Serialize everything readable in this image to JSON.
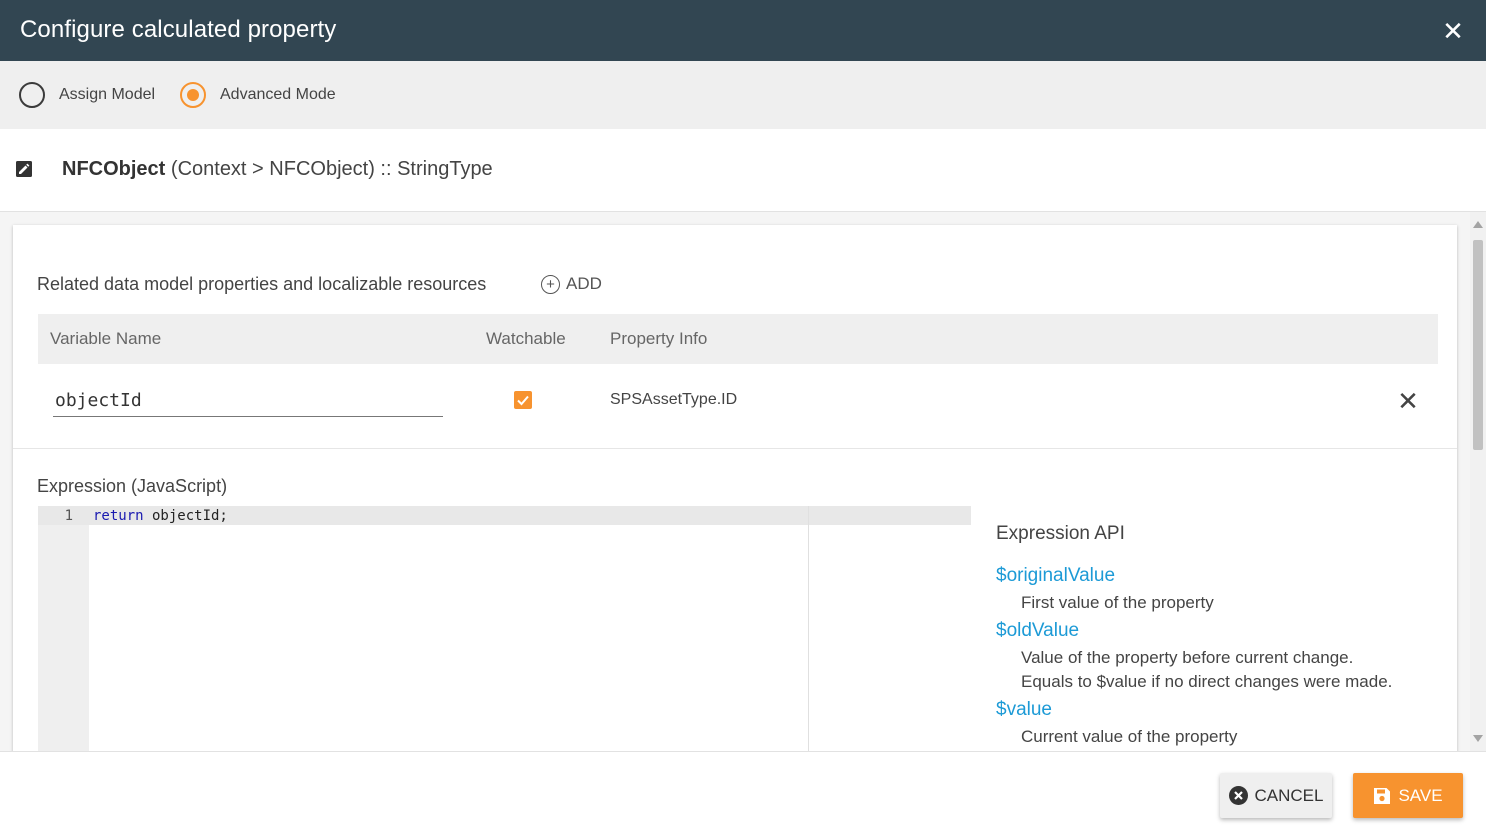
{
  "dialog": {
    "title": "Configure calculated property",
    "close_glyph": "✕"
  },
  "mode": {
    "options": [
      {
        "label": "Assign Model",
        "selected": false
      },
      {
        "label": "Advanced Mode",
        "selected": true
      }
    ]
  },
  "context": {
    "icon": "edit-square-icon",
    "object_name": "NFCObject",
    "path": "(Context > NFCObject) :: StringType"
  },
  "related": {
    "title": "Related data model properties and localizable resources",
    "add_label": "ADD",
    "columns": [
      "Variable Name",
      "Watchable",
      "Property Info"
    ],
    "rows": [
      {
        "variable_name": "objectId",
        "watchable": true,
        "property_info": "SPSAssetType.ID",
        "remove_glyph": "✕"
      }
    ]
  },
  "expression": {
    "title": "Expression (JavaScript)",
    "line_number": "1",
    "code_keyword": "return",
    "code_rest": " objectId;"
  },
  "api": {
    "title": "Expression API",
    "items": [
      {
        "name": "$originalValue",
        "desc": [
          "First value of the property"
        ]
      },
      {
        "name": "$oldValue",
        "desc": [
          "Value of the property before current change.",
          "Equals to $value if no direct changes were made."
        ]
      },
      {
        "name": "$value",
        "desc": [
          "Current value of the property"
        ]
      }
    ]
  },
  "footer": {
    "cancel_label": "CANCEL",
    "save_label": "SAVE"
  },
  "colors": {
    "header_bg": "#324652",
    "accent": "#f7932f",
    "link": "#1c9ad6"
  }
}
